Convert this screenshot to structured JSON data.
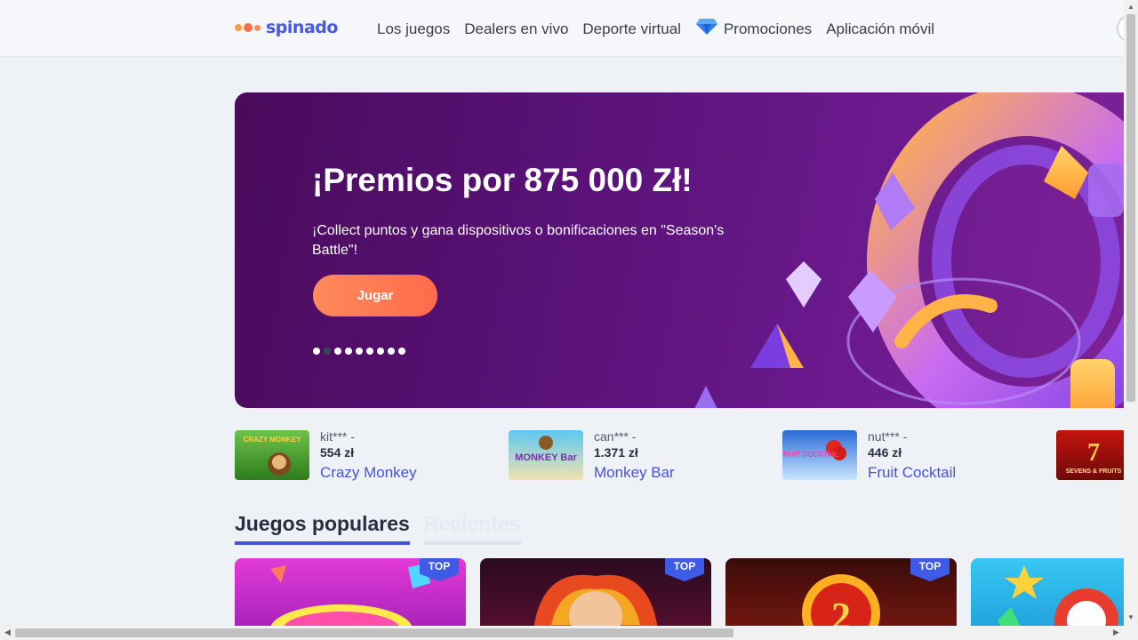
{
  "header": {
    "logo_text": "spinado",
    "nav": [
      {
        "label": "Los juegos"
      },
      {
        "label": "Dealers en vivo"
      },
      {
        "label": "Deporte virtual"
      },
      {
        "label": "Promociones",
        "icon": "diamond-icon"
      },
      {
        "label": "Aplicación móvil"
      }
    ]
  },
  "banner": {
    "title": "¡Premios por 875 000 Zł!",
    "subtitle": "¡Collect puntos y gana dispositivos o bonificaciones en \"Season's Battle\"!",
    "button_label": "Jugar",
    "slides_total": 9,
    "active_slide": 2
  },
  "winners": [
    {
      "user": "kit*** -",
      "amount": "554 zł",
      "game": "Crazy Monkey",
      "thumb_label": "CRAZY MONKEY"
    },
    {
      "user": "can*** -",
      "amount": "1.371 zł",
      "game": "Monkey Bar",
      "thumb_label": "MONKEY Bar"
    },
    {
      "user": "nut*** -",
      "amount": "446 zł",
      "game": "Fruit Cocktail",
      "thumb_label": "FRUIT COCKTAIL"
    },
    {
      "thumb_label": "SEVENS & FRUITS"
    }
  ],
  "tabs": [
    {
      "label": "Juegos populares",
      "active": true
    },
    {
      "label": "Recientes",
      "active": false
    }
  ],
  "games": [
    {
      "badge": "TOP"
    },
    {
      "badge": "TOP"
    },
    {
      "badge": "TOP"
    },
    {
      "badge": ""
    }
  ],
  "colors": {
    "accent": "#4653d8",
    "button": "#ff7a52",
    "banner_bg": "#5a1279"
  }
}
